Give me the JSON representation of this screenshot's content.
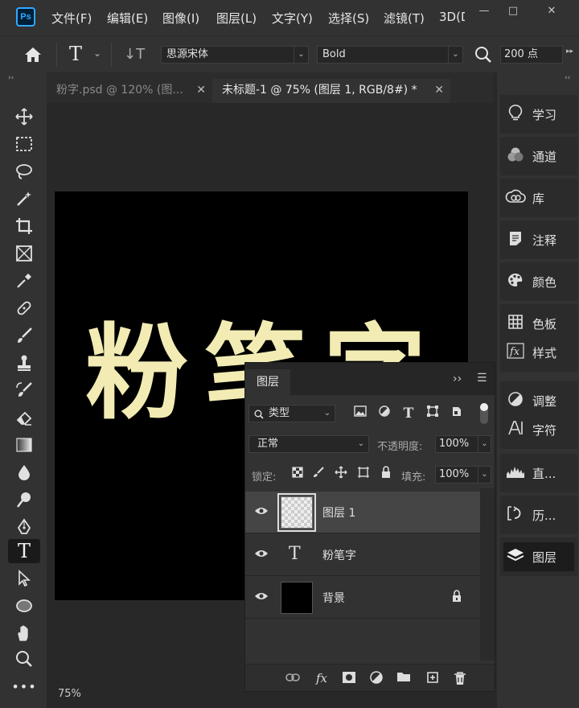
{
  "app": {
    "logo": "Ps"
  },
  "menu": [
    "文件(F)",
    "编辑(E)",
    "图像(I)",
    "图层(L)",
    "文字(Y)",
    "选择(S)",
    "滤镜(T)",
    "3D(D"
  ],
  "window_controls": {
    "minimize": "—",
    "restore": "□",
    "close": "✕"
  },
  "options": {
    "home_icon": "home-icon",
    "type_tool_glyph": "T",
    "type_tool_arrow": "⌄",
    "orient_glyph": "↓T",
    "font_family": "思源宋体",
    "font_style": "Bold",
    "font_size": "200 点",
    "arrow": "⌄",
    "more": "▸▸"
  },
  "tabs": [
    {
      "label": "粉字.psd @ 120% (图...",
      "close": "✕"
    },
    {
      "label": "未标题-1 @ 75% (图层 1, RGB/8#) *",
      "close": "✕"
    }
  ],
  "canvas": {
    "text": "粉笔字",
    "text_color": "#f2ecb4",
    "background": "#000000",
    "zoom": "75%"
  },
  "right_dock": [
    {
      "label": "学习",
      "icon": "lightbulb-icon"
    },
    {
      "label": "通道",
      "icon": "channels-icon"
    },
    {
      "label": "库",
      "icon": "cloud-library-icon"
    },
    {
      "label": "注释",
      "icon": "notes-icon"
    },
    {
      "label": "颜色",
      "icon": "palette-icon"
    },
    {
      "label": "色板",
      "icon": "swatches-icon"
    },
    {
      "label": "样式",
      "icon": "styles-icon"
    },
    {
      "label": "调整",
      "icon": "adjustments-icon"
    },
    {
      "label": "字符",
      "icon": "character-icon"
    },
    {
      "label": "直...",
      "icon": "histogram-icon"
    },
    {
      "label": "历...",
      "icon": "history-icon"
    },
    {
      "label": "图层",
      "icon": "layers-icon"
    }
  ],
  "layers_panel": {
    "title": "图层",
    "collapse": "››",
    "menu": "☰",
    "filter_label": "类型",
    "blend_mode": "正常",
    "opacity_label": "不透明度:",
    "opacity_value": "100%",
    "lock_label": "锁定:",
    "fill_label": "填充:",
    "fill_value": "100%",
    "arrow": "⌄",
    "layers": [
      {
        "name": "图层 1",
        "type": "pixel",
        "selected": true
      },
      {
        "name": "粉笔字",
        "type": "text",
        "glyph": "T",
        "selected": false
      },
      {
        "name": "背景",
        "type": "background",
        "locked": true,
        "selected": false
      }
    ],
    "footer_icons": [
      "link-icon",
      "fx-icon",
      "mask-icon",
      "adjustment-icon",
      "folder-icon",
      "new-layer-icon",
      "trash-icon"
    ],
    "footer_fx": "fx"
  }
}
